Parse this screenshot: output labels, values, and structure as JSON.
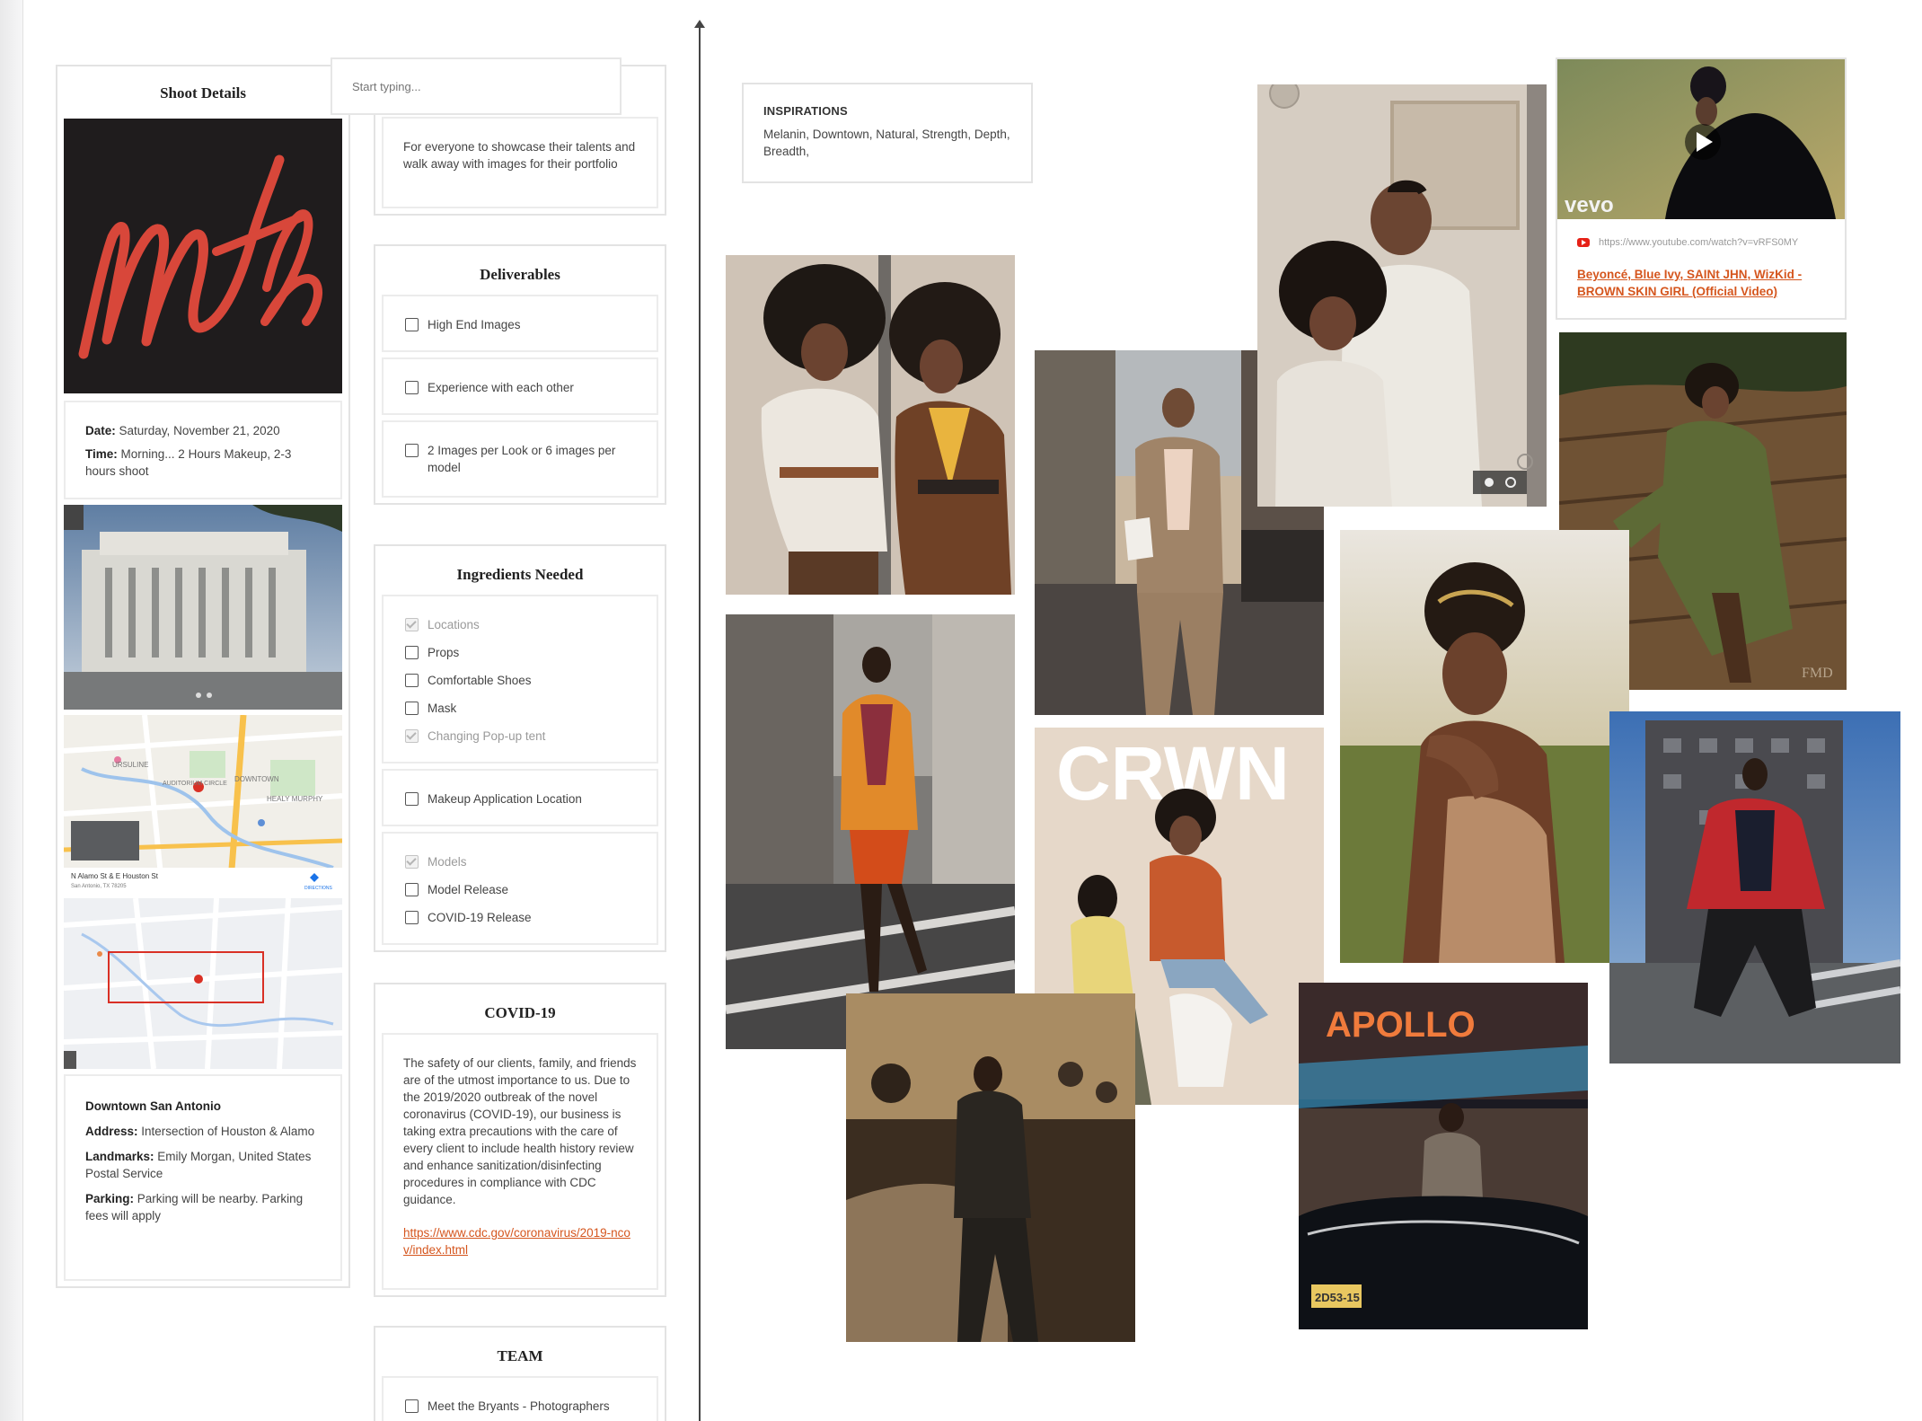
{
  "search": {
    "placeholder": "Start typing..."
  },
  "shoot_details": {
    "title": "Shoot Details",
    "logo_text": "mtb",
    "date_label": "Date:",
    "date_value": "Saturday, November 21, 2020",
    "time_label": "Time:",
    "time_value": "Morning... 2 Hours Makeup, 2-3 hours shoot",
    "map": {
      "labels": [
        "URSULINE",
        "AUDITORIUM CIRCLE",
        "DOWNTOWN",
        "HEALY MURPHY"
      ],
      "address_line1": "N Alamo St & E Houston St",
      "address_line2": "San Antonio, TX 78205",
      "directions": "DIRECTIONS"
    },
    "location_title": "Downtown San Antonio",
    "address_label": "Address:",
    "address_value": "Intersection of Houston & Alamo",
    "landmarks_label": "Landmarks:",
    "landmarks_value": "Emily Morgan, United States Postal Service",
    "parking_label": "Parking:",
    "parking_value": "Parking will be nearby. Parking fees will apply"
  },
  "purpose": {
    "text": "For everyone to showcase their talents and walk away with images for their portfolio"
  },
  "deliverables": {
    "title": "Deliverables",
    "items": [
      {
        "label": "High End Images",
        "checked": false
      },
      {
        "label": "Experience with each other",
        "checked": false
      },
      {
        "label": "2 Images per Look or 6 images per model",
        "checked": false
      }
    ]
  },
  "ingredients": {
    "title": "Ingredients Needed",
    "group1": [
      {
        "label": "Locations",
        "checked": true
      },
      {
        "label": "Props",
        "checked": false
      },
      {
        "label": "Comfortable Shoes",
        "checked": false
      },
      {
        "label": "Mask",
        "checked": false
      },
      {
        "label": "Changing Pop-up tent",
        "checked": true
      }
    ],
    "group2": [
      {
        "label": "Makeup Application Location",
        "checked": false
      }
    ],
    "group3": [
      {
        "label": "Models",
        "checked": true
      },
      {
        "label": "Model Release",
        "checked": false
      },
      {
        "label": "COVID-19 Release",
        "checked": false
      }
    ]
  },
  "covid": {
    "title": "COVID-19",
    "text": "The safety of our clients, family, and friends are of the utmost importance to us. Due to the 2019/2020 outbreak of the novel coronavirus (COVID-19), our business is taking extra precautions with the care of every client to include health history review and enhance sanitization/disinfecting procedures in compliance with CDC guidance.",
    "link": "https://www.cdc.gov/coronavirus/2019-ncov/index.html"
  },
  "team": {
    "title": "TEAM",
    "items": [
      {
        "label": "Meet the Bryants - Photographers",
        "checked": false
      }
    ]
  },
  "inspirations": {
    "title": "INSPIRATIONS",
    "text": "Melanin, Downtown, Natural, Strength, Depth, Breadth,"
  },
  "video": {
    "brand": "vevo",
    "url": "https://www.youtube.com/watch?v=vRFS0MY",
    "title": "Beyoncé, Blue Ivy, SAINt JHN, WizKid - BROWN SKIN GIRL (Official Video)"
  },
  "moodboard": {
    "crwn_text": "CRWN",
    "apollo_text": "APOLLO",
    "plate_text": "2D53-15",
    "watermark": "FMD"
  },
  "colors": {
    "accent": "#d5561e",
    "logo_red": "#d8473a",
    "logo_bg": "#1f1c1d"
  }
}
